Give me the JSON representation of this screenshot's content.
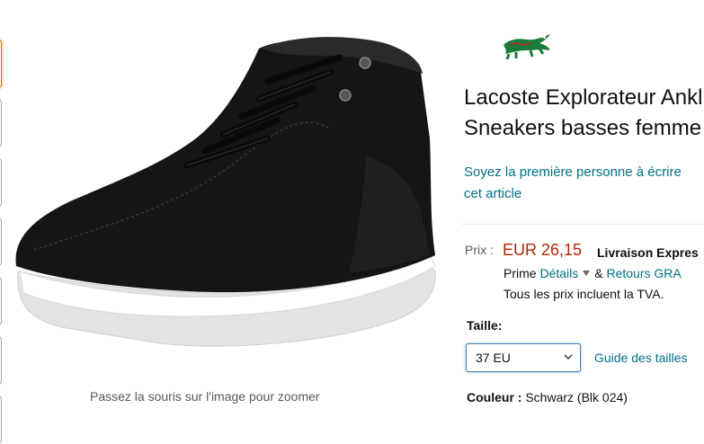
{
  "gallery": {
    "zoom_hint": "Passez la souris sur l'image pour zoomer",
    "thumbnail_count": 7
  },
  "brand": {
    "logo_icon": "crocodile-logo-icon",
    "color": "#1a7a3a"
  },
  "product": {
    "title_line1": "Lacoste Explorateur Ankl",
    "title_line2": "Sneakers basses femme",
    "review_line1": "Soyez la première personne à écrire",
    "review_line2": "cet article"
  },
  "pricing": {
    "label": "Prix :",
    "price": "EUR 26,15",
    "delivery": "Livraison Expres",
    "prime_word": "Prime",
    "details_link": "Détails",
    "separator": "&",
    "returns_link": "Retours GRA",
    "vat_note": "Tous les prix incluent la TVA."
  },
  "size": {
    "label": "Taille:",
    "selected": "37 EU",
    "guide_link": "Guide des tailles"
  },
  "color": {
    "label": "Couleur :",
    "value": "Schwarz (Blk 024)"
  },
  "colors": {
    "price": "#b12704",
    "link": "#007185",
    "focus_border": "#e77600"
  }
}
